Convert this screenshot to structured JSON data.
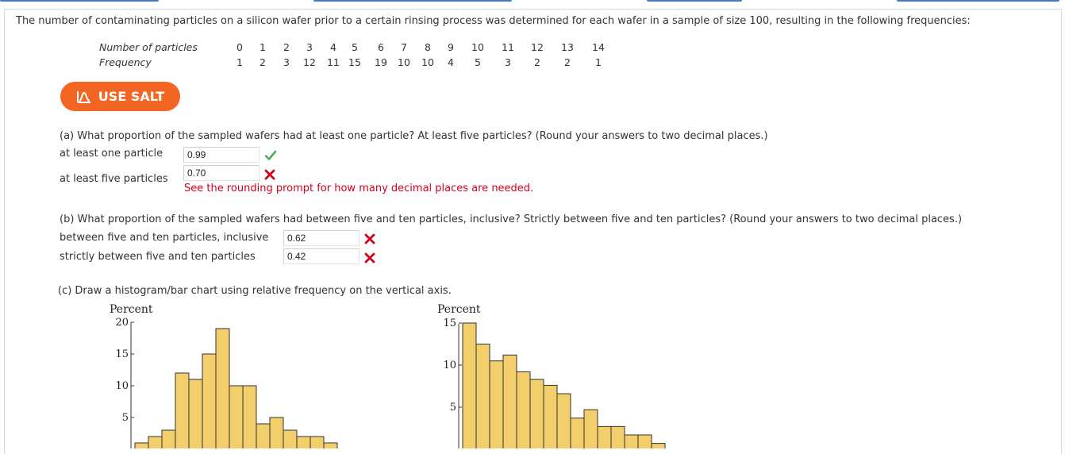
{
  "intro": "The number of contaminating particles on a silicon wafer prior to a certain rinsing process was determined for each wafer in a sample of size 100, resulting in the following frequencies:",
  "table": {
    "row1_label": "Number of particles",
    "row2_label": "Frequency",
    "particles": [
      "0",
      "1",
      "2",
      "3",
      "4",
      "5",
      "6",
      "7",
      "8",
      "9",
      "10",
      "11",
      "12",
      "13",
      "14"
    ],
    "frequencies": [
      "1",
      "2",
      "3",
      "12",
      "11",
      "15",
      "19",
      "10",
      "10",
      "4",
      "5",
      "3",
      "2",
      "2",
      "1"
    ]
  },
  "salt_button": "USE SALT",
  "part_a": {
    "question": "(a) What proportion of the sampled wafers had at least one particle? At least five particles? (Round your answers to two decimal places.)",
    "label1": "at least one particle",
    "value1": "0.99",
    "status1": "correct",
    "label2": "at least five particles",
    "value2": "0.70",
    "status2": "incorrect",
    "error_msg": "See the rounding prompt for how many decimal places are needed."
  },
  "part_b": {
    "question": "(b) What proportion of the sampled wafers had between five and ten particles, inclusive? Strictly between five and ten particles? (Round your answers to two decimal places.)",
    "label1": "between five and ten particles, inclusive",
    "value1": "0.62",
    "status1": "incorrect",
    "label2": "strictly between five and ten particles",
    "value2": "0.42",
    "status2": "incorrect"
  },
  "part_c": {
    "question": "(c) Draw a histogram/bar chart using relative frequency on the vertical axis."
  },
  "colors": {
    "bar_fill": "#f2cf6a",
    "bar_stroke": "#333333",
    "correct": "#4caf50",
    "incorrect": "#d0021b",
    "salt": "#f26522",
    "top_rule": "#4a78c2"
  },
  "chart_data": [
    {
      "type": "bar",
      "ylabel": "Percent",
      "ylim": [
        0,
        20
      ],
      "yticks": [
        "5",
        "10",
        "15",
        "20"
      ],
      "values": [
        1,
        2,
        3,
        12,
        11,
        15,
        19,
        10,
        10,
        4,
        5,
        3,
        2,
        2,
        1
      ]
    },
    {
      "type": "bar",
      "ylabel": "Percent",
      "ylim": [
        0,
        15
      ],
      "yticks": [
        "5",
        "10",
        "15"
      ],
      "values": [
        15,
        12.5,
        10.5,
        11.2,
        9.2,
        8.3,
        7.6,
        6.6,
        3.7,
        4.7,
        2.7,
        2.7,
        1.7,
        1.7,
        0.7
      ]
    }
  ]
}
